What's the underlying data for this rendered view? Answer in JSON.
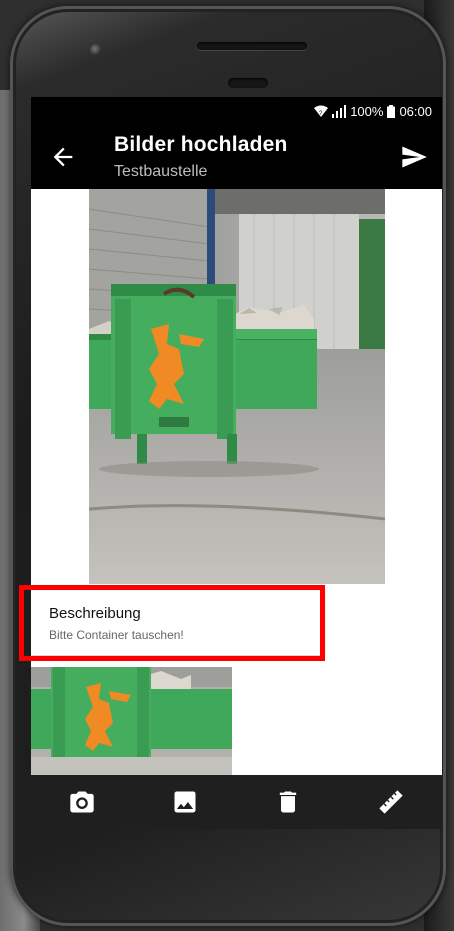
{
  "status_bar": {
    "battery": "100%",
    "time": "06:00",
    "icons": [
      "wifi-icon",
      "signal-icon",
      "battery-icon"
    ]
  },
  "app_bar": {
    "title": "Bilder hochladen",
    "subtitle": "Testbaustelle",
    "back_icon": "arrow-back-icon",
    "send_icon": "send-icon"
  },
  "photo": {
    "description_label": "Beschreibung",
    "description_value": "Bitte Container tauschen!"
  },
  "toolbar": {
    "icons": [
      "camera-icon",
      "image-icon",
      "delete-icon",
      "ruler-icon"
    ]
  },
  "colors": {
    "app_bar": "#000000",
    "toolbar": "#1f1f1f",
    "highlight": "#ff0000",
    "container_green": "#3fa85a",
    "logo_orange": "#f08a24"
  }
}
